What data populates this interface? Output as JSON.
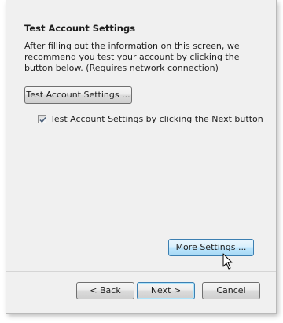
{
  "dialog": {
    "section_title": "Test Account Settings",
    "description": "After filling out the information on this screen, we recommend you test your account by clicking the button below. (Requires network connection)",
    "test_button_label": "Test Account Settings ...",
    "auto_test_checkbox": {
      "label": "Test Account Settings by clicking the Next button",
      "checked": true
    },
    "more_settings_label": "More Settings ..."
  },
  "footer": {
    "back_label": "< Back",
    "next_label": "Next >",
    "cancel_label": "Cancel"
  },
  "icons": {
    "cursor": "mouse-pointer-icon",
    "check": "checkmark-icon"
  },
  "colors": {
    "dialog_background": "#f0f0f0",
    "default_button_border": "#3c7fb1",
    "hover_button_fill": "#bee6fd"
  }
}
